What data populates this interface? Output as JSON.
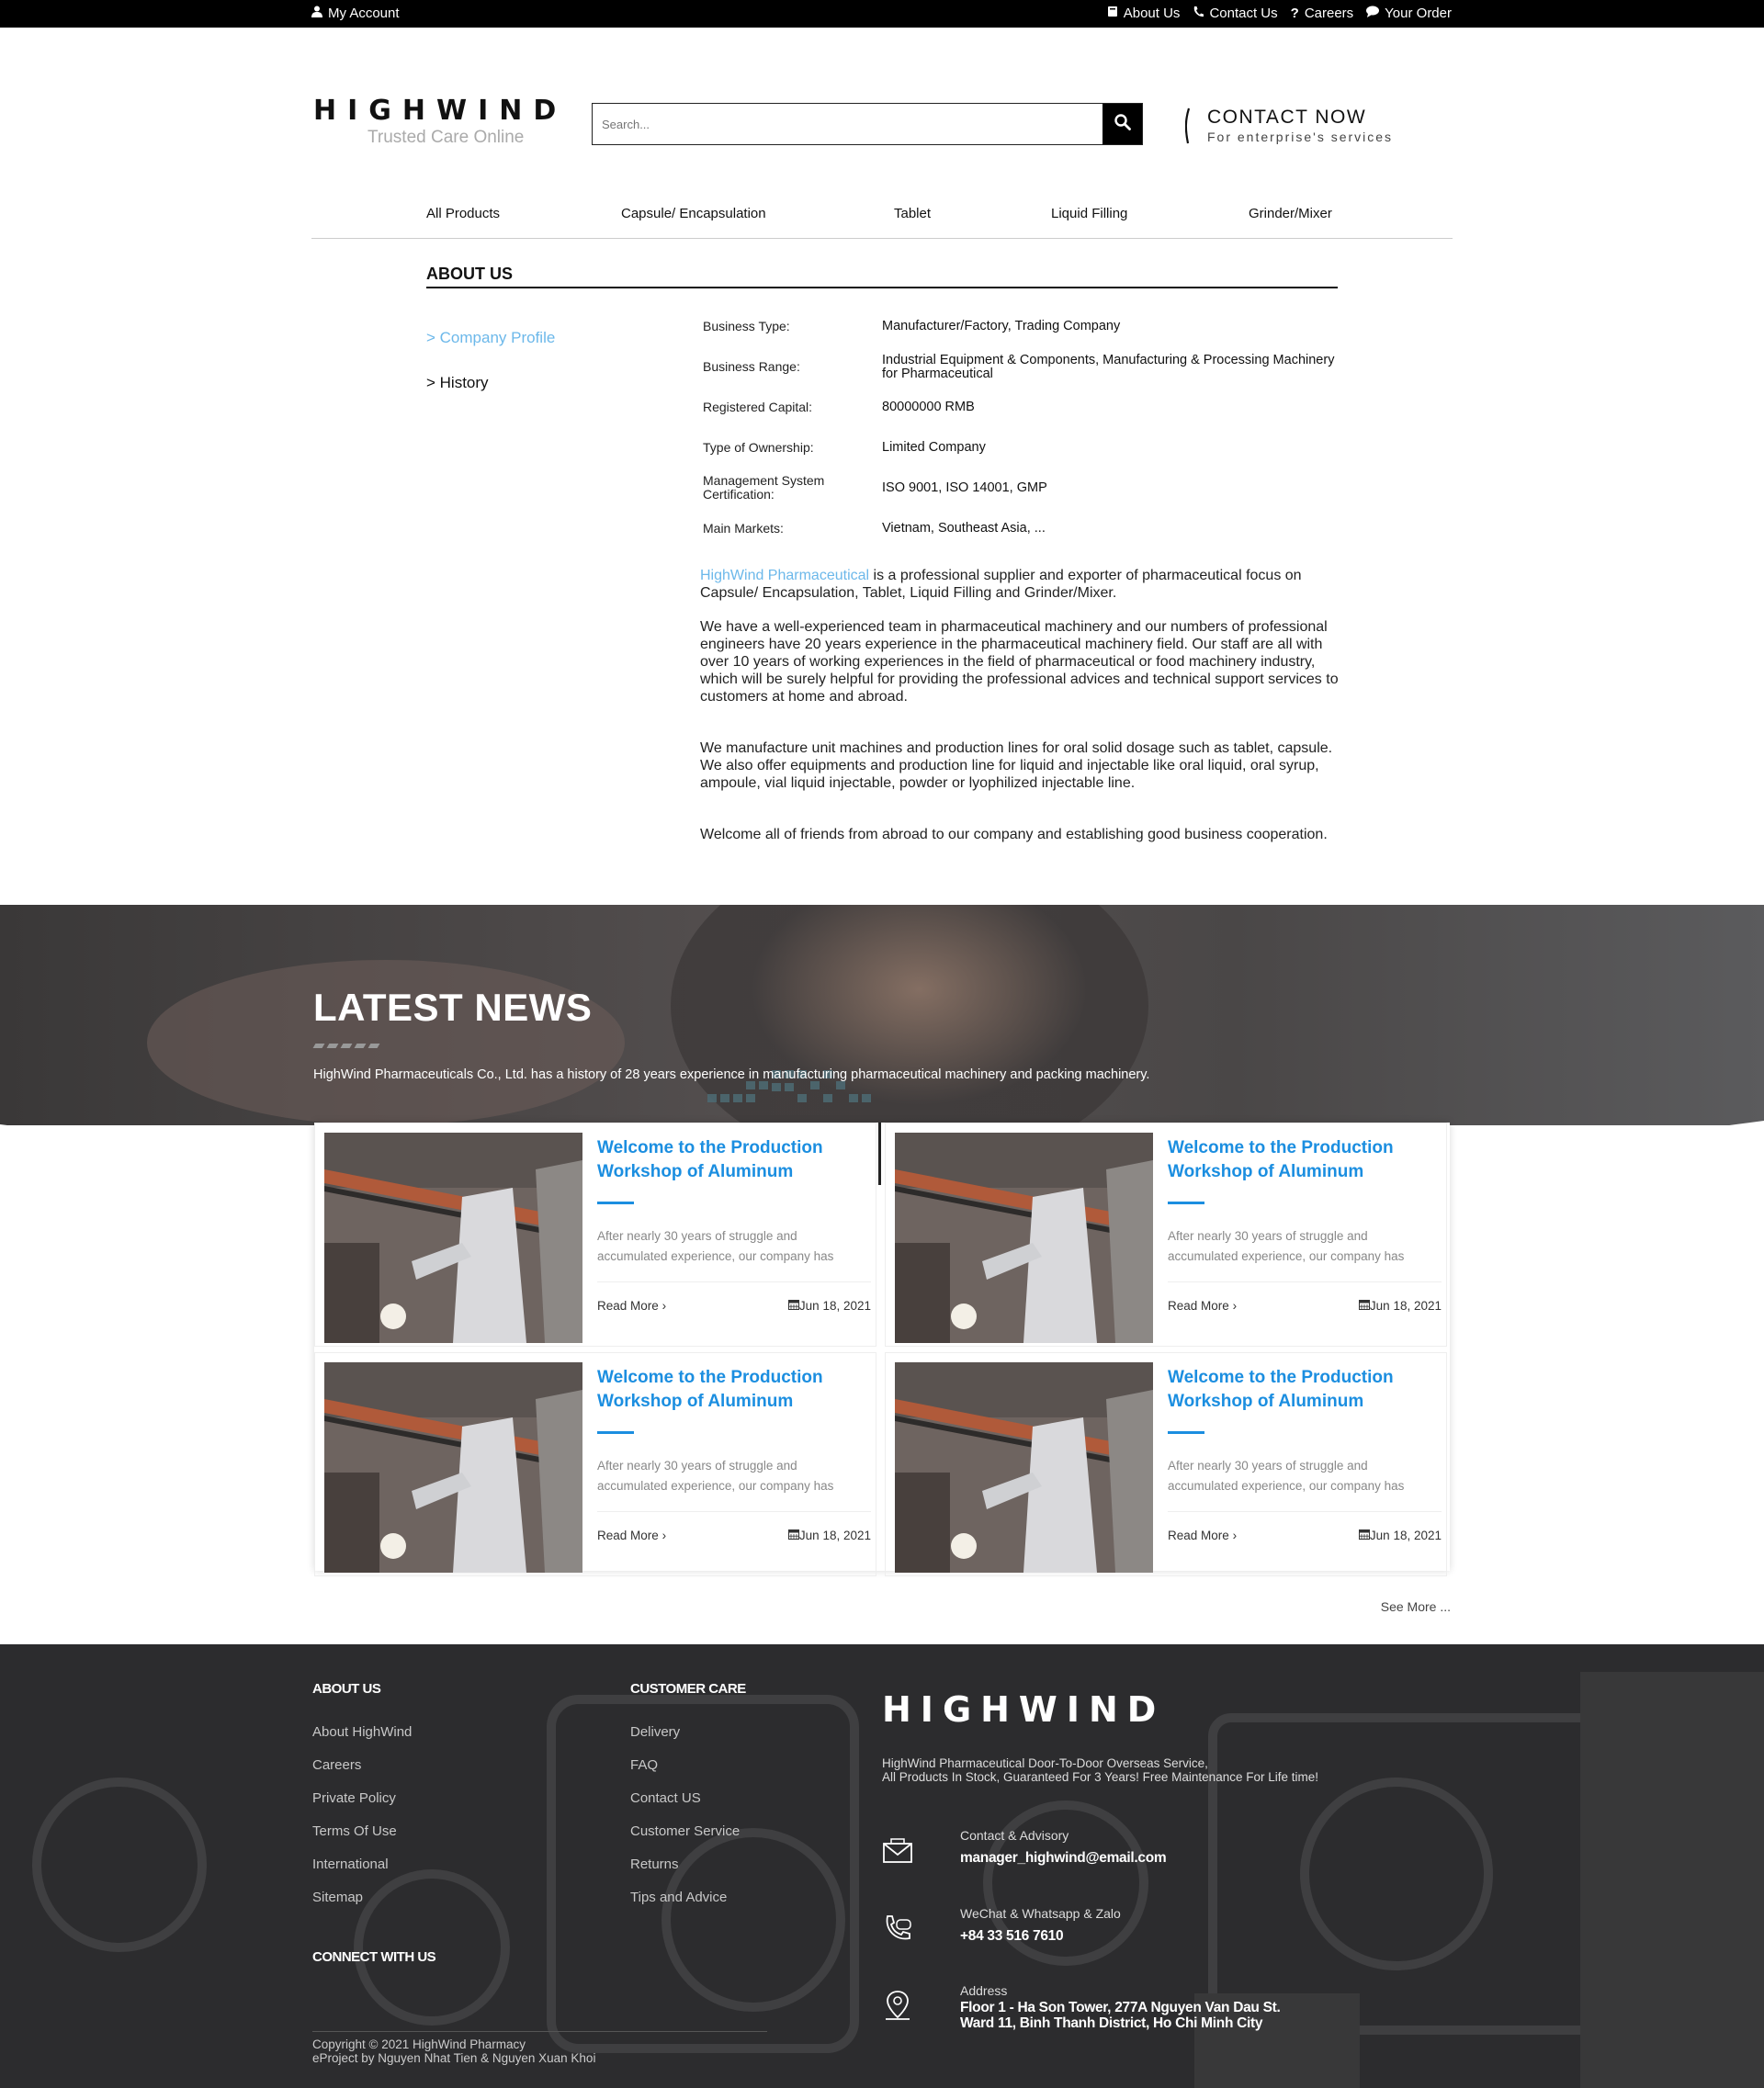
{
  "topbar": {
    "account": "My Account",
    "links": [
      "About Us",
      "Contact Us",
      "Careers",
      "Your Order"
    ]
  },
  "header": {
    "logo": "HIGHWIND",
    "tagline": "Trusted Care Online",
    "search_placeholder": "Search...",
    "contact_title": "CONTACT NOW",
    "contact_sub": "For enterprise's services"
  },
  "nav": [
    "All Products",
    "Capsule/ Encapsulation",
    "Tablet",
    "Liquid Filling",
    "Grinder/Mixer"
  ],
  "about": {
    "title": "ABOUT US",
    "side": [
      "> Company Profile",
      "> History"
    ],
    "rows": [
      {
        "label": "Business Type:",
        "value": "Manufacturer/Factory, Trading Company"
      },
      {
        "label": "Business Range:",
        "value": "Industrial Equipment & Components, Manufacturing & Processing Machinery for Pharmaceutical"
      },
      {
        "label": "Registered Capital:",
        "value": "80000000 RMB"
      },
      {
        "label": "Type of Ownership:",
        "value": "Limited Company"
      },
      {
        "label": "Management System Certification:",
        "value": "ISO 9001, ISO 14001, GMP"
      },
      {
        "label": "Main Markets:",
        "value": "Vietnam, Southeast Asia, ..."
      }
    ],
    "intro_highlight": "HighWind Pharmaceutical",
    "intro_rest": " is a professional supplier and exporter of pharmaceutical focus on Capsule/ Encapsulation, Tablet, Liquid Filling and Grinder/Mixer.",
    "p2": "We have a well-experienced team in pharmaceutical machinery and our numbers of professional engineers have 20 years experience in the pharmaceutical machinery field. Our staff are all with over 10 years of working experiences in the field of pharmaceutical or food machinery industry, which will be surely helpful for providing the professional advices and technical support services to customers at home and abroad.",
    "p3": "We manufacture unit machines and production lines for oral solid dosage such as tablet, capsule. We also offer equipments and production line for liquid and injectable like oral liquid, oral syrup, ampoule, vial liquid injectable, powder or lyophilized injectable line.",
    "p4": "Welcome all of friends from abroad to our company and establishing good business cooperation."
  },
  "news": {
    "title": "LATEST NEWS",
    "subtitle": "HighWind Pharmaceuticals Co., Ltd. has a history of 28 years experience in manufacturing pharmaceutical machinery and packing machinery.",
    "cards": [
      {
        "title": "Welcome to the Production Workshop of Aluminum",
        "excerpt": "After nearly 30 years of struggle and accumulated experience, our company has",
        "read": "Read More",
        "date": "Jun 18, 2021"
      },
      {
        "title": "Welcome to the Production Workshop of Aluminum",
        "excerpt": "After nearly 30 years of struggle and accumulated experience, our company has",
        "read": "Read More",
        "date": "Jun 18, 2021"
      },
      {
        "title": "Welcome to the Production Workshop of Aluminum",
        "excerpt": "After nearly 30 years of struggle and accumulated experience, our company has",
        "read": "Read More",
        "date": "Jun 18, 2021"
      },
      {
        "title": "Welcome to the Production Workshop of Aluminum",
        "excerpt": "After nearly 30 years of struggle and accumulated experience, our company has",
        "read": "Read More",
        "date": "Jun 18, 2021"
      }
    ],
    "see_more": "See More ..."
  },
  "footer": {
    "about_h": "ABOUT US",
    "about_links": [
      "About HighWind",
      "Careers",
      "Private Policy",
      "Terms Of Use",
      "International",
      "Sitemap"
    ],
    "care_h": "CUSTOMER CARE",
    "care_links": [
      "Delivery",
      "FAQ",
      "Contact US",
      "Customer Service",
      "Returns",
      "Tips and Advice"
    ],
    "connect_h": "CONNECT WITH US",
    "brand": "HIGHWIND",
    "brand_desc_1": "HighWind Pharmaceutical Door-To-Door Overseas Service,",
    "brand_desc_2": "All Products In Stock, Guaranteed For 3 Years! Free Maintenance For Life time!",
    "contact_label": "Contact & Advisory",
    "contact_value": "manager_highwind@email.com",
    "phone_label": "WeChat & Whatsapp & Zalo",
    "phone_value": "+84 33 516 7610",
    "address_label": "Address",
    "address_line1": "Floor 1 - Ha Son Tower, 277A Nguyen Van Dau St.",
    "address_line2": "Ward 11, Binh Thanh District, Ho Chi Minh City",
    "copyright_1": "Copyright © 2021 HighWind Pharmacy",
    "copyright_2": "eProject by Nguyen Nhat Tien & Nguyen Xuan Khoi"
  }
}
